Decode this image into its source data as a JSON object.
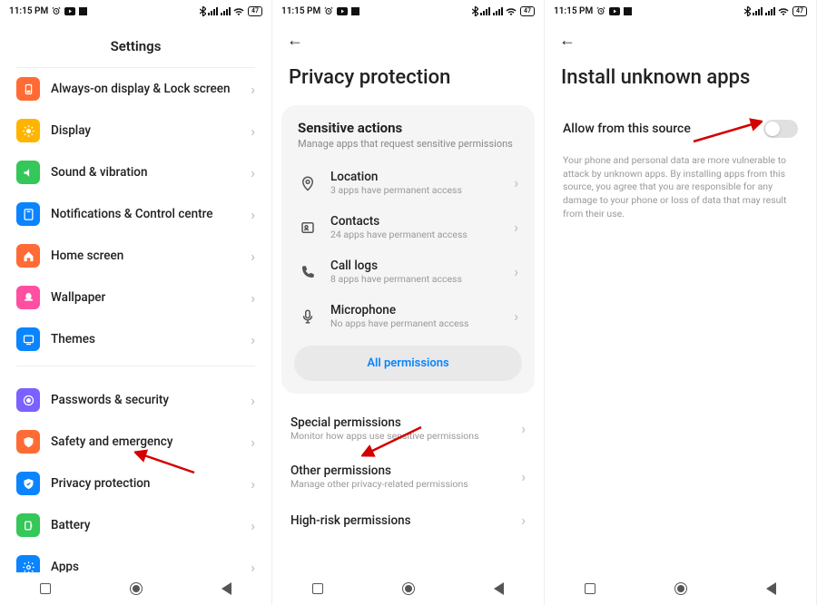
{
  "status": {
    "time": "11:15 PM",
    "battery": "47"
  },
  "screen1": {
    "title": "Settings",
    "items": [
      {
        "label": "Always-on display & Lock screen",
        "color": "#ff6b35"
      },
      {
        "label": "Display",
        "color": "#ffb400"
      },
      {
        "label": "Sound & vibration",
        "color": "#34c759"
      },
      {
        "label": "Notifications & Control centre",
        "color": "#0a84ff"
      },
      {
        "label": "Home screen",
        "color": "#ff6b35"
      },
      {
        "label": "Wallpaper",
        "color": "#ff4fa1"
      },
      {
        "label": "Themes",
        "color": "#0a84ff"
      }
    ],
    "items2": [
      {
        "label": "Passwords & security",
        "color": "#7b61ff"
      },
      {
        "label": "Safety and emergency",
        "color": "#ff6b35"
      },
      {
        "label": "Privacy protection",
        "color": "#0a84ff"
      },
      {
        "label": "Battery",
        "color": "#34c759"
      },
      {
        "label": "Apps",
        "color": "#0a84ff"
      }
    ]
  },
  "screen2": {
    "title": "Privacy protection",
    "card_title": "Sensitive actions",
    "card_sub": "Manage apps that request sensitive permissions",
    "sensitive": [
      {
        "label": "Location",
        "desc": "3 apps have permanent access"
      },
      {
        "label": "Contacts",
        "desc": "24 apps have permanent access"
      },
      {
        "label": "Call logs",
        "desc": "8 apps have permanent access"
      },
      {
        "label": "Microphone",
        "desc": "No apps have permanent access"
      }
    ],
    "all_perm": "All permissions",
    "extra": [
      {
        "label": "Special permissions",
        "desc": "Monitor how apps use sensitive permissions"
      },
      {
        "label": "Other permissions",
        "desc": "Manage other privacy-related permissions"
      },
      {
        "label": "High-risk permissions",
        "desc": ""
      }
    ]
  },
  "screen3": {
    "title": "Install unknown apps",
    "toggle_label": "Allow from this source",
    "toggle_on": false,
    "warning": "Your phone and personal data are more vulnerable to attack by unknown apps. By installing apps from this source, you agree that you are responsible for any damage to your phone or loss of data that may result from their use."
  }
}
